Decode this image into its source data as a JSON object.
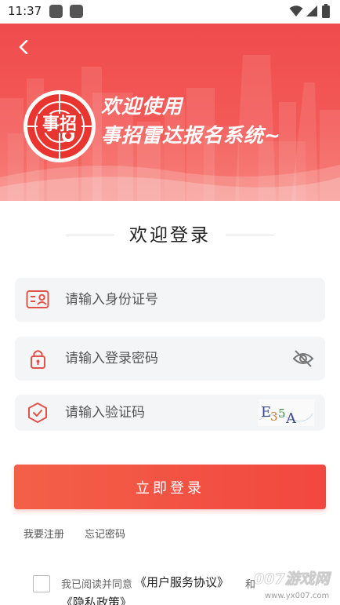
{
  "status_bar": {
    "time": "11:37"
  },
  "banner": {
    "slogan_line1": "欢迎使用",
    "slogan_line2": "事招雷达报名系统~",
    "logo_text": "事招",
    "colors": {
      "background": "#f05050",
      "text": "#ffffff"
    }
  },
  "page_title": "欢迎登录",
  "form": {
    "id_field": {
      "placeholder": "请输入身份证号",
      "value": "",
      "icon": "id-card-icon"
    },
    "password_field": {
      "placeholder": "请输入登录密码",
      "value": "",
      "icon": "lock-icon",
      "toggle_icon": "eye-off-icon"
    },
    "captcha_field": {
      "placeholder": "请输入验证码",
      "value": "",
      "icon": "shield-check-icon",
      "captcha_text": "E35A"
    }
  },
  "login_button": "立即登录",
  "links": {
    "register": "我要注册",
    "forgot_password": "忘记密码"
  },
  "agreement": {
    "prefix": "我已阅读并同意",
    "user_agreement": "《用户服务协议》",
    "and": "和",
    "privacy_policy": "《隐私政策》",
    "checked": false
  },
  "watermark": {
    "line1": "007游戏网",
    "line2": "www.yx007.com"
  },
  "colors": {
    "accent": "#f24a40",
    "field_background": "#f4f5f7",
    "icon": "#e0534a"
  }
}
